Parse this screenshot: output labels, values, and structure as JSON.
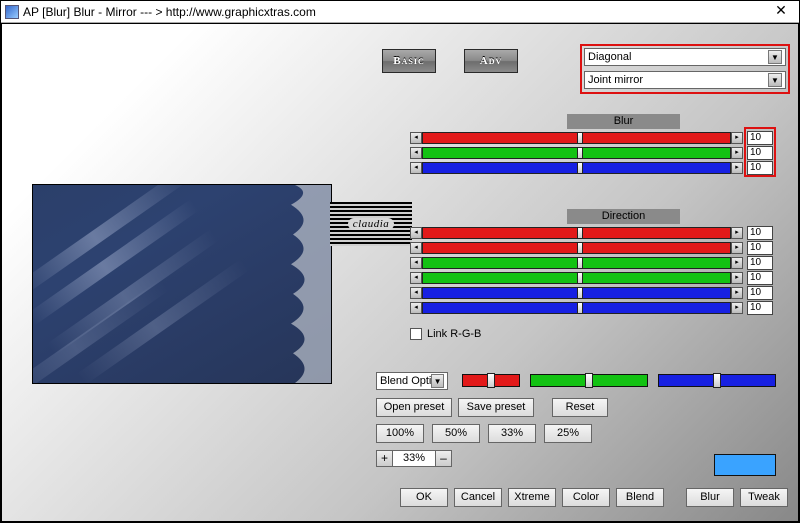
{
  "title": "AP [Blur]  Blur - Mirror    --- >  http://www.graphicxtras.com",
  "tabs": {
    "basic": "Basic",
    "adv": "Adv"
  },
  "dropdowns": {
    "mode": "Diagonal",
    "type": "Joint mirror",
    "blend": "Blend Optic"
  },
  "sections": {
    "blur": "Blur",
    "direction": "Direction"
  },
  "blur": {
    "r": "10",
    "g": "10",
    "b": "10"
  },
  "direction": {
    "v1": "10",
    "v2": "10",
    "v3": "10",
    "v4": "10",
    "v5": "10",
    "v6": "10"
  },
  "linkLabel": "Link R-G-B",
  "buttons": {
    "openPreset": "Open preset",
    "savePreset": "Save preset",
    "reset": "Reset"
  },
  "zoomPresets": {
    "p100": "100%",
    "p50": "50%",
    "p33": "33%",
    "p25": "25%"
  },
  "zoom": {
    "plus": "+",
    "minus": "–",
    "value": "33%"
  },
  "swatchColor": "#3aa3ff",
  "bottom": {
    "ok": "OK",
    "cancel": "Cancel",
    "xtreme": "Xtreme",
    "color": "Color",
    "blend": "Blend",
    "blur": "Blur",
    "tweak": "Tweak"
  },
  "watermark": "claudia",
  "colors": {
    "red": "#e21919",
    "green": "#13c213",
    "blue": "#1720e2"
  }
}
